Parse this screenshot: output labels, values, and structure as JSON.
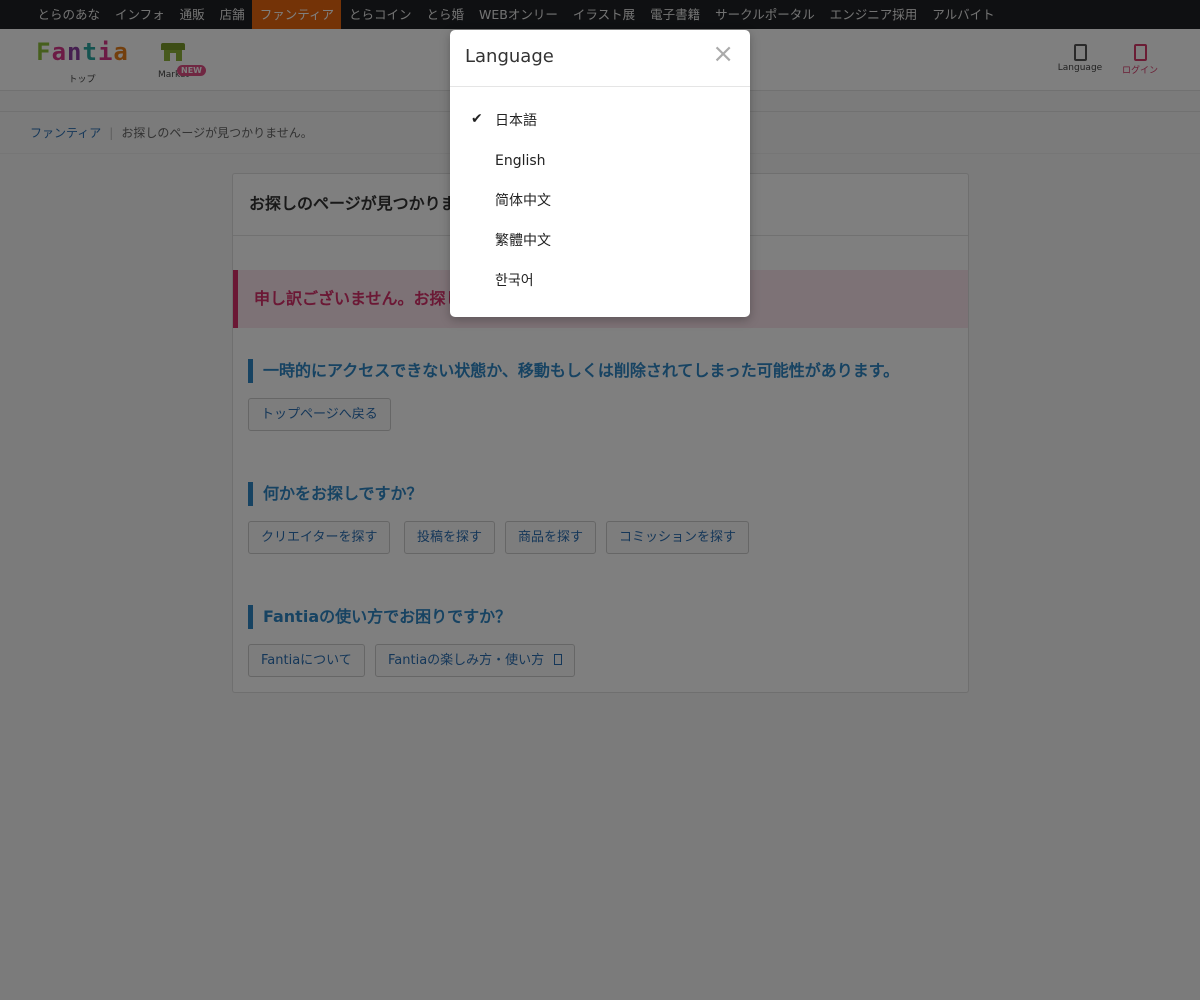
{
  "topnav": [
    {
      "label": "とらのあな",
      "active": false
    },
    {
      "label": "インフォ",
      "active": false
    },
    {
      "label": "通販",
      "active": false
    },
    {
      "label": "店舗",
      "active": false
    },
    {
      "label": "ファンティア",
      "active": true
    },
    {
      "label": "とらコイン",
      "active": false
    },
    {
      "label": "とら婚",
      "active": false
    },
    {
      "label": "WEBオンリー",
      "active": false
    },
    {
      "label": "イラスト展",
      "active": false
    },
    {
      "label": "電子書籍",
      "active": false
    },
    {
      "label": "サークルポータル",
      "active": false
    },
    {
      "label": "エンジニア採用",
      "active": false
    },
    {
      "label": "アルバイト",
      "active": false
    }
  ],
  "header": {
    "logo_letters": [
      "F",
      "a",
      "n",
      "t",
      "i",
      "a"
    ],
    "logo_colors": [
      "#8dbf3a",
      "#d9378a",
      "#8a3ea0",
      "#2aa6a0",
      "#d9378a",
      "#e77f1a"
    ],
    "logo_caption": "トップ",
    "market_badge": "NEW",
    "market_caption": "Market",
    "language_label": "Language",
    "login_label": "ログイン"
  },
  "breadcrumb": {
    "home": "ファンティア",
    "current": "お探しのページが見つかりません。"
  },
  "card": {
    "title": "お探しのページが見つかりません。",
    "alert": "申し訳ございません。お探しのページが見つかりません。",
    "section1_title": "一時的にアクセスできない状態か、移動もしくは削除されてしまった可能性があります。",
    "section1_button": "トップページへ戻る",
    "section2_title": "何かをお探しですか？",
    "section2_buttons": [
      "クリエイターを探す",
      "投稿を探す",
      "商品を探す",
      "コミッションを探す"
    ],
    "section3_title": "Fantiaの使い方でお困りですか？",
    "section3_buttons": [
      "Fantiaについて",
      "Fantiaの楽しみ方・使い方"
    ]
  },
  "modal": {
    "title": "Language",
    "close_symbol": "×",
    "check_symbol": "✔",
    "languages": [
      {
        "label": "日本語",
        "selected": true
      },
      {
        "label": "English",
        "selected": false
      },
      {
        "label": "简体中文",
        "selected": false
      },
      {
        "label": "繁體中文",
        "selected": false
      },
      {
        "label": "한국어",
        "selected": false
      }
    ]
  }
}
